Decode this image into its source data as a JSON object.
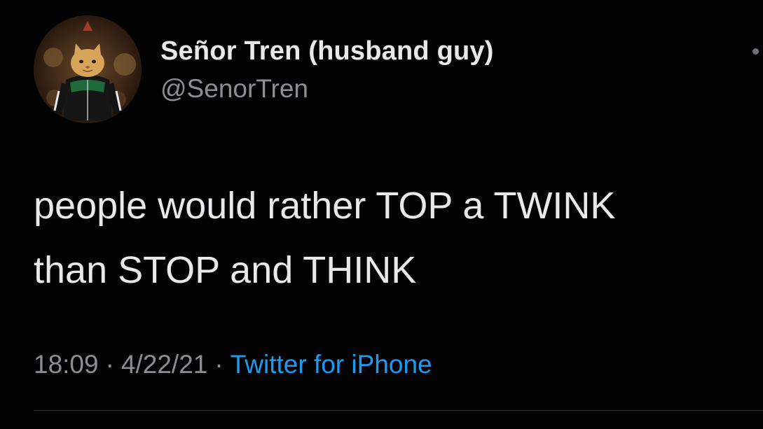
{
  "author": {
    "display_name": "Señor Tren (husband guy)",
    "handle": "@SenorTren",
    "avatar_icon": "cat-in-tracksuit-avatar"
  },
  "tweet": {
    "text_lines": [
      "people would rather TOP a TWINK",
      "than STOP and THINK"
    ]
  },
  "meta": {
    "time": "18:09",
    "date": "4/22/21",
    "separator": "·",
    "source": "Twitter for iPhone"
  },
  "more_icon": "more-options-icon",
  "colors": {
    "background": "#030303",
    "text": "#e7e9ea",
    "secondary": "#8b8f93",
    "link": "#1d9bf0"
  }
}
